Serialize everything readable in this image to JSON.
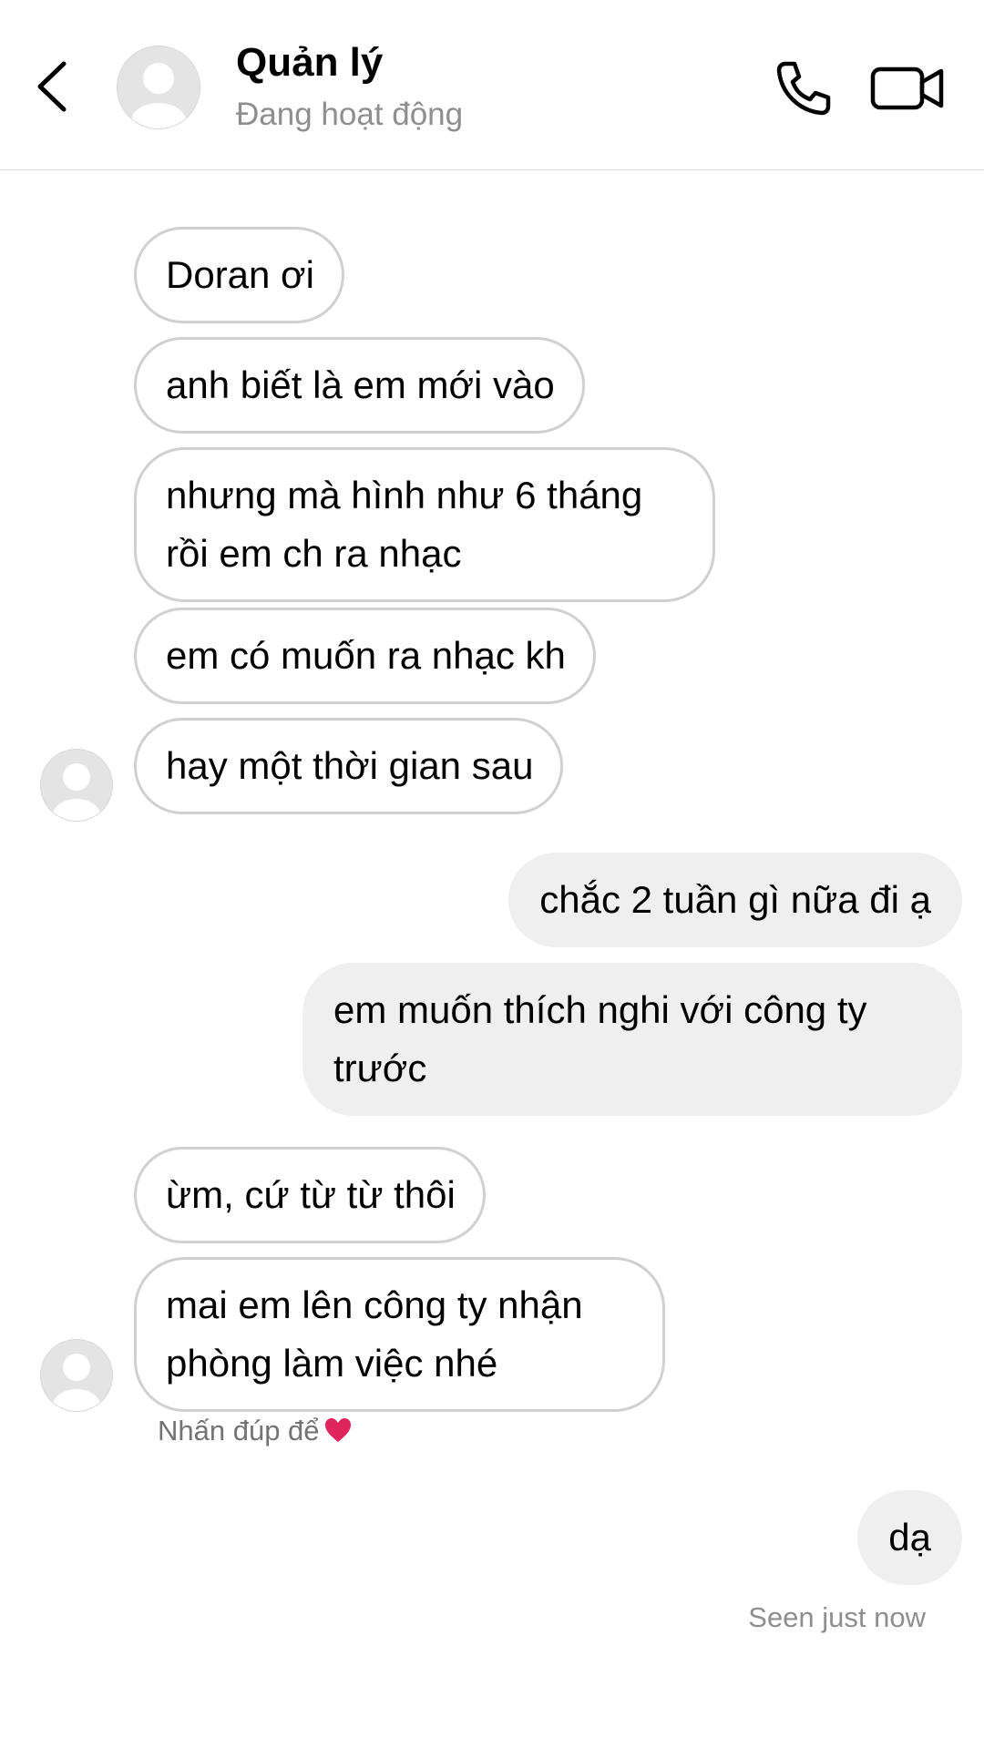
{
  "header": {
    "contact_name": "Quản lý",
    "contact_status": "Đang hoạt động",
    "icons": {
      "back": "chevron-left-icon",
      "call": "phone-icon",
      "video": "video-camera-icon"
    }
  },
  "messages": [
    {
      "sender": "contact",
      "text": "Doran ơi"
    },
    {
      "sender": "contact",
      "text": "anh biết là em mới vào"
    },
    {
      "sender": "contact",
      "text": "nhưng mà hình như 6 tháng rồi em ch ra nhạc"
    },
    {
      "sender": "contact",
      "text": "em có muốn ra nhạc kh"
    },
    {
      "sender": "contact",
      "text": "hay một thời gian sau"
    },
    {
      "sender": "me",
      "text": "chắc 2 tuần gì nữa đi ạ"
    },
    {
      "sender": "me",
      "text": "em muốn thích nghi với công ty trước"
    },
    {
      "sender": "contact",
      "text": "ừm, cứ từ từ thôi"
    },
    {
      "sender": "contact",
      "text": "mai em lên công ty nhận phòng làm việc nhé"
    },
    {
      "sender": "me",
      "text": "dạ"
    }
  ],
  "double_tap_hint": "Nhấn đúp để",
  "seen_status": "Seen just now",
  "colors": {
    "incoming_border": "#d0d0d0",
    "outgoing_background": "#efefef",
    "secondary_text": "#8e8e8e",
    "heart": "#e0245e"
  }
}
